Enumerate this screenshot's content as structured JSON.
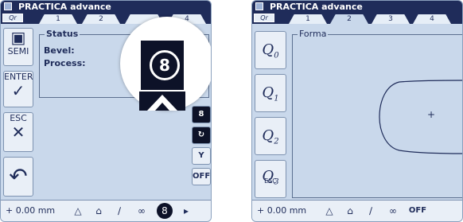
{
  "screen1": {
    "title": "PRACTICA advance",
    "qr_label": "Qr",
    "tabs": [
      "1",
      "2",
      "",
      "4"
    ],
    "left_buttons": [
      {
        "label": "SEMI",
        "icon": "camera-icon"
      },
      {
        "label": "ENTER",
        "glyph": "✓"
      },
      {
        "label": "ESC",
        "glyph": "✕"
      },
      {
        "label": "",
        "glyph": "↶"
      }
    ],
    "status": {
      "legend": "Status",
      "bevel_label": "Bevel:",
      "process_label": "Process:"
    },
    "magnified_value": "8",
    "right_buttons": [
      "8",
      "↻",
      "Y",
      "OFF"
    ],
    "bottom": {
      "value": "+ 0.00",
      "unit": "mm",
      "badge": "8"
    }
  },
  "screen2": {
    "title": "PRACTICA advance",
    "qr_label": "Qr",
    "tabs": [
      "1",
      "2",
      "3",
      "4"
    ],
    "q_buttons": [
      {
        "q": "Q",
        "sub": "0"
      },
      {
        "q": "Q",
        "sub": "1"
      },
      {
        "q": "Q",
        "sub": "2"
      },
      {
        "q": "Q",
        "sub": "3",
        "esc": "ESC"
      }
    ],
    "forma": {
      "legend": "Forma",
      "center_mark": "+"
    },
    "bottom": {
      "value": "+ 0.00",
      "unit": "mm",
      "off": "OFF"
    }
  }
}
